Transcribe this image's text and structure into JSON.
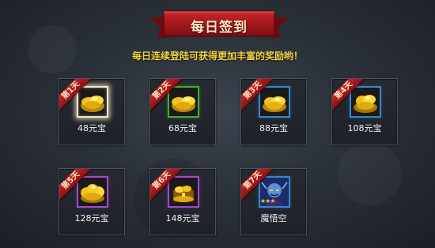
{
  "header": {
    "title": "每日签到",
    "subtitle": "每日连续登陆可获得更加丰富的奖励哟！"
  },
  "rewards": [
    {
      "day": "第1天",
      "label": "48元宝",
      "frame": "today",
      "icon": "gold-ingots-icon"
    },
    {
      "day": "第2天",
      "label": "68元宝",
      "frame": "green",
      "icon": "gold-ingots-icon"
    },
    {
      "day": "第3天",
      "label": "88元宝",
      "frame": "blue",
      "icon": "gold-ingots-icon"
    },
    {
      "day": "第4天",
      "label": "108元宝",
      "frame": "blue",
      "icon": "gold-ingots-icon"
    },
    {
      "day": "第5天",
      "label": "128元宝",
      "frame": "purple",
      "icon": "gold-ingots-icon"
    },
    {
      "day": "第6天",
      "label": "148元宝",
      "frame": "purple",
      "icon": "gold-treasure-chest-icon"
    },
    {
      "day": "第7天",
      "label": "魔悟空",
      "frame": "blue",
      "icon": "hero-portrait-icon",
      "stars": "★★★"
    }
  ],
  "colors": {
    "ribbon": "#b51b1f",
    "subtitle": "#f5d542",
    "frame_green": "#47a83b",
    "frame_blue": "#3b86c6",
    "frame_purple": "#a24bc7"
  }
}
